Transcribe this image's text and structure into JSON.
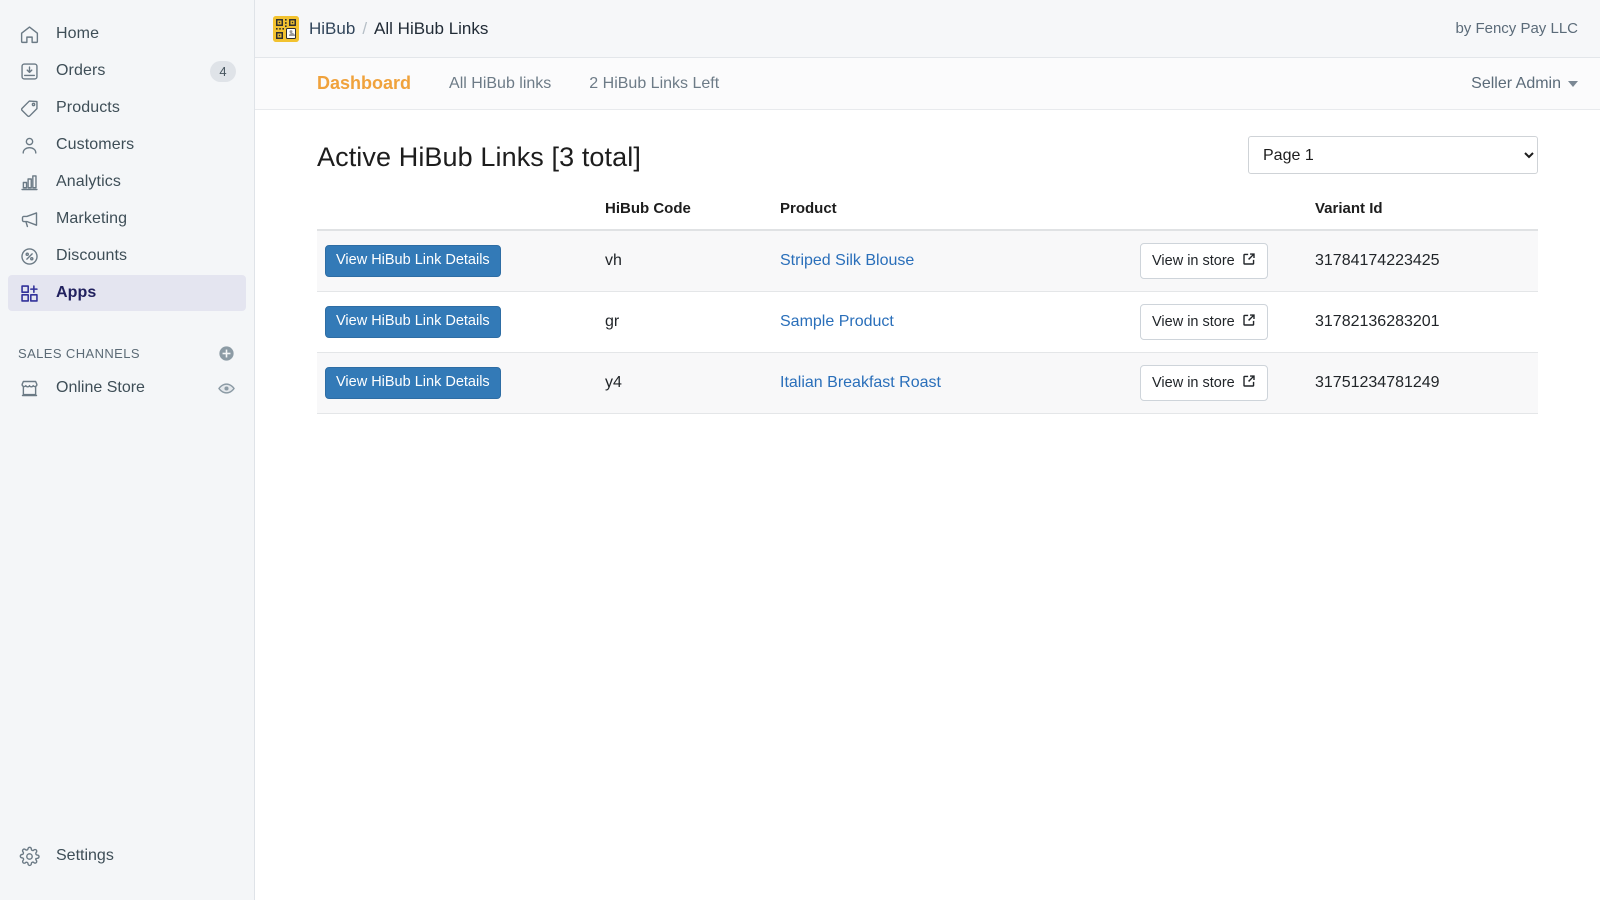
{
  "sidebar": {
    "items": [
      {
        "label": "Home",
        "icon": "home-icon",
        "badge": null,
        "active": false
      },
      {
        "label": "Orders",
        "icon": "orders-icon",
        "badge": "4",
        "active": false
      },
      {
        "label": "Products",
        "icon": "products-icon",
        "badge": null,
        "active": false
      },
      {
        "label": "Customers",
        "icon": "customers-icon",
        "badge": null,
        "active": false
      },
      {
        "label": "Analytics",
        "icon": "analytics-icon",
        "badge": null,
        "active": false
      },
      {
        "label": "Marketing",
        "icon": "marketing-icon",
        "badge": null,
        "active": false
      },
      {
        "label": "Discounts",
        "icon": "discounts-icon",
        "badge": null,
        "active": false
      },
      {
        "label": "Apps",
        "icon": "apps-icon",
        "badge": null,
        "active": true
      }
    ],
    "sales_channels": {
      "heading": "SALES CHANNELS",
      "add_icon": "plus-circle-icon",
      "items": [
        {
          "label": "Online Store",
          "icon": "storefront-icon",
          "trailing_icon": "eye-icon"
        }
      ]
    },
    "settings": {
      "label": "Settings",
      "icon": "gear-icon"
    }
  },
  "topbar": {
    "logo_icon": "hibub-qr-logo",
    "breadcrumb_app": "HiBub",
    "breadcrumb_separator": "/",
    "breadcrumb_current": "All HiBub Links",
    "developer": "by Fency Pay LLC"
  },
  "tabbar": {
    "tabs": [
      {
        "label": "Dashboard",
        "active": true
      },
      {
        "label": "All HiBub links",
        "active": false
      },
      {
        "label": "2 HiBub Links Left",
        "active": false
      }
    ],
    "account_label": "Seller Admin",
    "account_caret_icon": "chevron-down-icon"
  },
  "main": {
    "page_title": "Active HiBub Links [3 total]",
    "page_select": {
      "value": "Page 1",
      "options": [
        "Page 1"
      ]
    },
    "table": {
      "headers": [
        "",
        "HiBub Code",
        "Product",
        "",
        "Variant Id"
      ],
      "action_label": "View HiBub Link Details",
      "store_label": "View in store",
      "store_icon": "external-link-icon",
      "rows": [
        {
          "code": "vh",
          "product": "Striped Silk Blouse",
          "variant_id": "31784174223425"
        },
        {
          "code": "gr",
          "product": "Sample Product",
          "variant_id": "31782136283201"
        },
        {
          "code": "y4",
          "product": "Italian Breakfast Roast",
          "variant_id": "31751234781249"
        }
      ]
    }
  },
  "colors": {
    "accent_orange": "#f0a23c",
    "primary_blue": "#337ab7",
    "link_blue": "#2a6fba",
    "sidebar_bg": "#f4f6f8",
    "active_item_bg": "#e4e5f0",
    "logo_yellow": "#f2c230"
  }
}
